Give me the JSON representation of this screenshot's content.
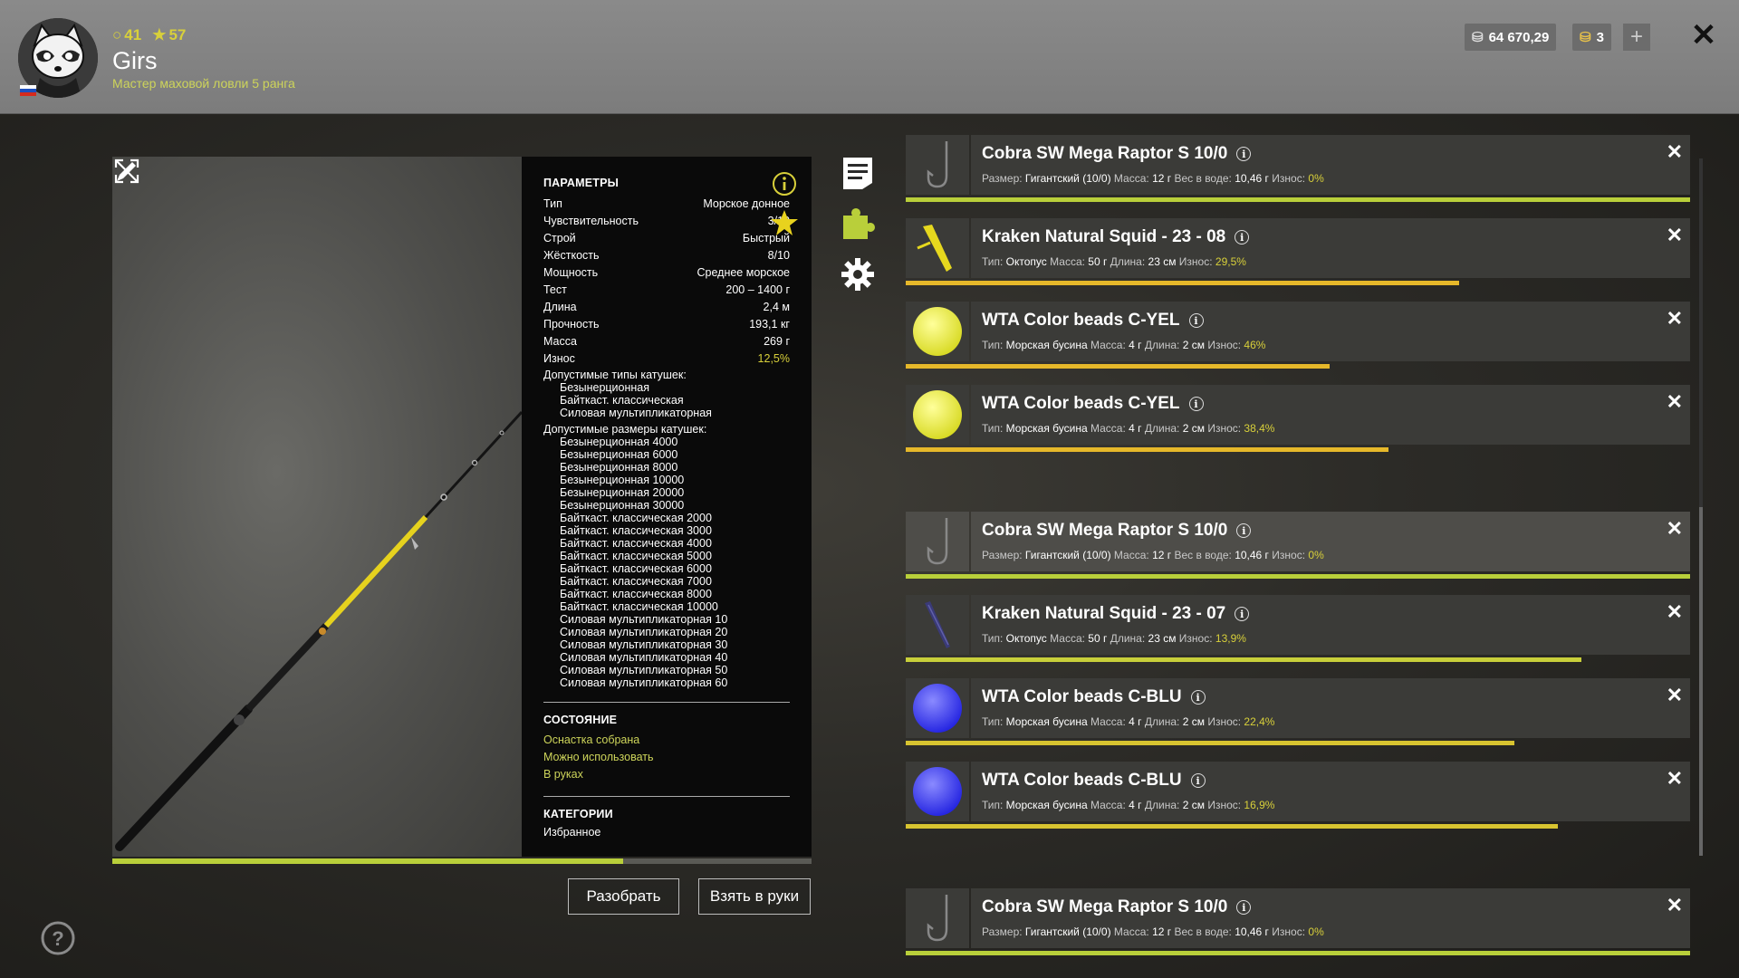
{
  "player": {
    "level": "41",
    "stars": "57",
    "name": "Girs",
    "rank": "Мастер маховой ловли 5 ранга"
  },
  "wallet": {
    "silver": "64 670,29",
    "gold": "3"
  },
  "params": {
    "title": "ПАРАМЕТРЫ",
    "rows": [
      {
        "label": "Тип",
        "value": "Морское донное"
      },
      {
        "label": "Чувствительность",
        "value": "3/10"
      },
      {
        "label": "Строй",
        "value": "Быстрый"
      },
      {
        "label": "Жёсткость",
        "value": "8/10"
      },
      {
        "label": "Мощность",
        "value": "Среднее морское"
      },
      {
        "label": "Тест",
        "value": "200 – 1400 г"
      },
      {
        "label": "Длина",
        "value": "2,4 м"
      },
      {
        "label": "Прочность",
        "value": "193,1 кг"
      },
      {
        "label": "Масса",
        "value": "269 г"
      },
      {
        "label": "Износ",
        "value": "12,5%"
      }
    ],
    "reel_types_title": "Допустимые типы катушек:",
    "reel_types": [
      "Безынерционная",
      "Байткаст. классическая",
      "Силовая мультипликаторная"
    ],
    "reel_sizes_title": "Допустимые размеры катушек:",
    "reel_sizes": [
      "Безынерционная 4000",
      "Безынерционная 6000",
      "Безынерционная 8000",
      "Безынерционная 10000",
      "Безынерционная 20000",
      "Безынерционная 30000",
      "Байткаст. классическая 2000",
      "Байткаст. классическая 3000",
      "Байткаст. классическая 4000",
      "Байткаст. классическая 5000",
      "Байткаст. классическая 6000",
      "Байткаст. классическая 7000",
      "Байткаст. классическая 8000",
      "Байткаст. классическая 10000",
      "Силовая мультипликаторная 10",
      "Силовая мультипликаторная 20",
      "Силовая мультипликаторная 30",
      "Силовая мультипликаторная 40",
      "Силовая мультипликаторная 50",
      "Силовая мультипликаторная 60"
    ],
    "state_title": "СОСТОЯНИЕ",
    "states": [
      "Оснастка собрана",
      "Можно использовать",
      "В руках"
    ],
    "categories_title": "КАТЕГОРИИ",
    "categories": [
      "Избранное"
    ]
  },
  "rod_condition": 0.73,
  "buttons": {
    "disassemble": "Разобрать",
    "take": "Взять в руки"
  },
  "items": [
    {
      "name": "Cobra SW Mega Raptor S 10/0",
      "kind": "hook",
      "meta": [
        [
          "Размер:",
          "Гигантский (10/0)"
        ],
        [
          "Масса:",
          "12 г"
        ],
        [
          "Вес в воде:",
          "10,46 г"
        ]
      ],
      "wear_label": "Износ:",
      "wear": "0%",
      "condition": 1.0,
      "bar_color": "#b9cf3a",
      "highlight": false
    },
    {
      "name": "Kraken Natural Squid - 23 - 08",
      "kind": "squid-yellow",
      "meta": [
        [
          "Тип:",
          "Октопус"
        ],
        [
          "Масса:",
          "50 г"
        ],
        [
          "Длина:",
          "23 см"
        ]
      ],
      "wear_label": "Износ:",
      "wear": "29,5%",
      "condition": 0.705,
      "bar_color": "#e6b82a",
      "highlight": false
    },
    {
      "name": "WTA Color beads C-YEL",
      "kind": "bead-yellow",
      "meta": [
        [
          "Тип:",
          "Морская бусина"
        ],
        [
          "Масса:",
          "4 г"
        ],
        [
          "Длина:",
          "2 см"
        ]
      ],
      "wear_label": "Износ:",
      "wear": "46%",
      "condition": 0.54,
      "bar_color": "#e6b82a",
      "highlight": false
    },
    {
      "name": "WTA Color beads C-YEL",
      "kind": "bead-yellow",
      "meta": [
        [
          "Тип:",
          "Морская бусина"
        ],
        [
          "Масса:",
          "4 г"
        ],
        [
          "Длина:",
          "2 см"
        ]
      ],
      "wear_label": "Износ:",
      "wear": "38,4%",
      "condition": 0.616,
      "bar_color": "#e6b82a",
      "highlight": false
    },
    {
      "name": "Cobra SW Mega Raptor S 10/0",
      "kind": "hook",
      "meta": [
        [
          "Размер:",
          "Гигантский (10/0)"
        ],
        [
          "Масса:",
          "12 г"
        ],
        [
          "Вес в воде:",
          "10,46 г"
        ]
      ],
      "wear_label": "Износ:",
      "wear": "0%",
      "condition": 1.0,
      "bar_color": "#b9cf3a",
      "highlight": true
    },
    {
      "name": "Kraken Natural Squid - 23 - 07",
      "kind": "squid-purple",
      "meta": [
        [
          "Тип:",
          "Октопус"
        ],
        [
          "Масса:",
          "50 г"
        ],
        [
          "Длина:",
          "23 см"
        ]
      ],
      "wear_label": "Износ:",
      "wear": "13,9%",
      "condition": 0.861,
      "bar_color": "#c8cf3a",
      "highlight": false
    },
    {
      "name": "WTA Color beads C-BLU",
      "kind": "bead-blue",
      "meta": [
        [
          "Тип:",
          "Морская бусина"
        ],
        [
          "Масса:",
          "4 г"
        ],
        [
          "Длина:",
          "2 см"
        ]
      ],
      "wear_label": "Износ:",
      "wear": "22,4%",
      "condition": 0.776,
      "bar_color": "#d8c430",
      "highlight": false
    },
    {
      "name": "WTA Color beads C-BLU",
      "kind": "bead-blue",
      "meta": [
        [
          "Тип:",
          "Морская бусина"
        ],
        [
          "Масса:",
          "4 г"
        ],
        [
          "Длина:",
          "2 см"
        ]
      ],
      "wear_label": "Износ:",
      "wear": "16,9%",
      "condition": 0.831,
      "bar_color": "#d8c430",
      "highlight": false
    },
    {
      "name": "Cobra SW Mega Raptor S 10/0",
      "kind": "hook",
      "meta": [
        [
          "Размер:",
          "Гигантский (10/0)"
        ],
        [
          "Масса:",
          "12 г"
        ],
        [
          "Вес в воде:",
          "10,46 г"
        ]
      ],
      "wear_label": "Износ:",
      "wear": "0%",
      "condition": 1.0,
      "bar_color": "#b9cf3a",
      "highlight": false
    }
  ],
  "colors": {
    "accent": "#d8d03a",
    "green_text": "#cdd45a",
    "panel": "#0a0a0a"
  }
}
